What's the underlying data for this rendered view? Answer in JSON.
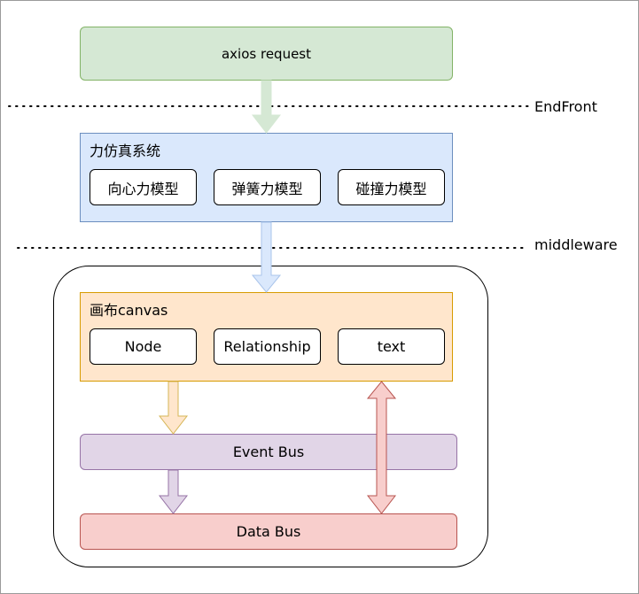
{
  "request": {
    "label": "axios request"
  },
  "layers": {
    "endfront": "EndFront",
    "middleware": "middleware"
  },
  "physics": {
    "title": "力仿真系统",
    "models": [
      "向心力模型",
      "弹簧力模型",
      "碰撞力模型"
    ]
  },
  "canvas": {
    "title": "画布canvas",
    "items": [
      "Node",
      "Relationship",
      "text"
    ]
  },
  "event_bus": {
    "label": "Event Bus"
  },
  "data_bus": {
    "label": "Data Bus"
  },
  "colors": {
    "green_fill": "#d5e8d4",
    "blue_fill": "#dae8fc",
    "orange_fill": "#ffe6cc",
    "purple_fill": "#e1d5e7",
    "red_fill": "#f8cecc"
  }
}
